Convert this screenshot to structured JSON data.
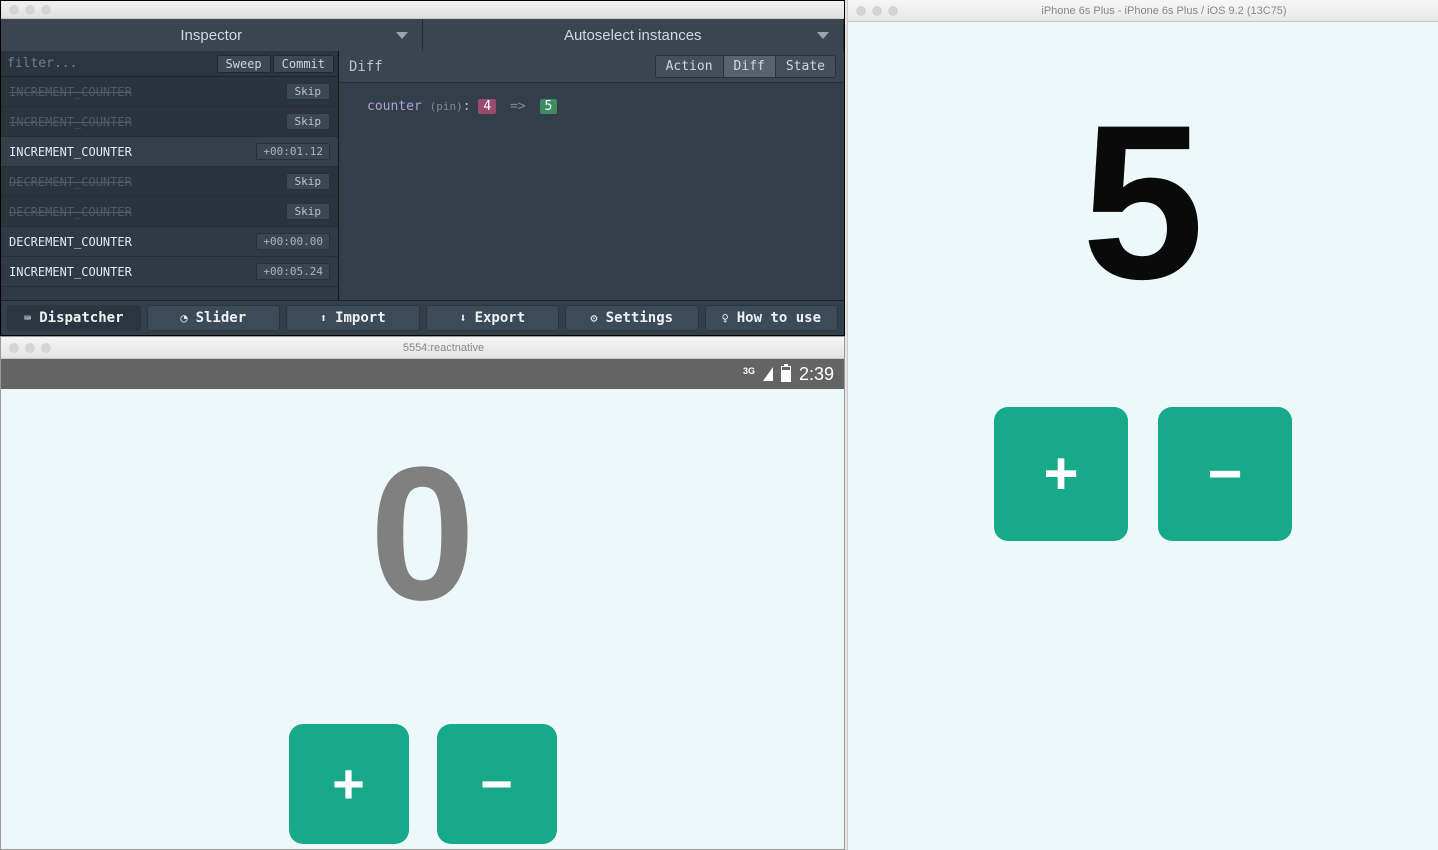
{
  "devtools": {
    "tabs": {
      "inspector": "Inspector",
      "instances": "Autoselect instances"
    },
    "filter_placeholder": "filter...",
    "sweep": "Sweep",
    "commit": "Commit",
    "actions": [
      {
        "label": "INCREMENT_COUNTER",
        "skipped": true,
        "time": null
      },
      {
        "label": "INCREMENT_COUNTER",
        "skipped": true,
        "time": null
      },
      {
        "label": "INCREMENT_COUNTER",
        "skipped": false,
        "time": "+00:01.12",
        "selected": true
      },
      {
        "label": "DECREMENT_COUNTER",
        "skipped": true,
        "time": null
      },
      {
        "label": "DECREMENT_COUNTER",
        "skipped": true,
        "time": null
      },
      {
        "label": "DECREMENT_COUNTER",
        "skipped": false,
        "time": "+00:00.00"
      },
      {
        "label": "INCREMENT_COUNTER",
        "skipped": false,
        "time": "+00:05.24"
      }
    ],
    "skip_label": "Skip",
    "diff": {
      "title": "Diff",
      "seg_action": "Action",
      "seg_diff": "Diff",
      "seg_state": "State",
      "key": "counter",
      "meta": "(pin)",
      "old": "4",
      "arrow": "=>",
      "new": "5"
    },
    "toolbar": {
      "dispatcher": "Dispatcher",
      "slider": "Slider",
      "import": "Import",
      "export": "Export",
      "settings": "Settings",
      "howto": "How to use"
    }
  },
  "android": {
    "title": "5554:reactnative",
    "status": {
      "net": "3G",
      "time": "2:39"
    },
    "counter": "0",
    "plus": "+",
    "minus": "−"
  },
  "iphone": {
    "title": "iPhone 6s Plus - iPhone 6s Plus / iOS 9.2 (13C75)",
    "counter": "5",
    "plus": "+",
    "minus": "−"
  }
}
